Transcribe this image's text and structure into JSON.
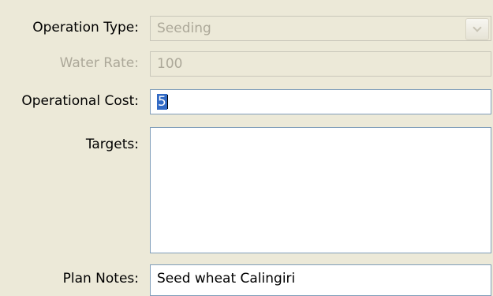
{
  "form": {
    "operation_type": {
      "label": "Operation Type:",
      "value": "Seeding",
      "disabled": true,
      "dropdown_icon": "chevron-down-icon"
    },
    "water_rate": {
      "label": "Water Rate:",
      "value": "100",
      "disabled": true
    },
    "operational_cost": {
      "label": "Operational Cost:",
      "value": "5",
      "selected": true
    },
    "targets": {
      "label": "Targets:",
      "value": ""
    },
    "plan_notes": {
      "label": "Plan Notes:",
      "value": "Seed wheat Calingiri"
    }
  },
  "colors": {
    "background": "#ECE9D8",
    "field_border": "#7F9DB9",
    "disabled_text": "#ACA899",
    "selection": "#316AC5"
  }
}
